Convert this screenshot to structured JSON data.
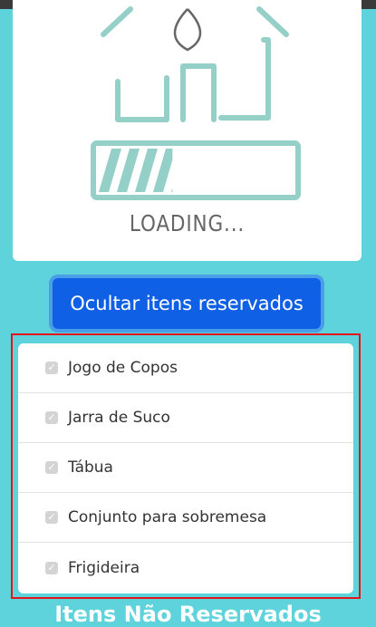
{
  "loading": {
    "text": "LOADING...",
    "progress": 0.38,
    "accent_color": "#94cfc8"
  },
  "toggle_button": {
    "label": "Ocultar itens reservados"
  },
  "reserved_items": [
    {
      "label": "Jogo de Copos",
      "checked": true
    },
    {
      "label": "Jarra de Suco",
      "checked": true
    },
    {
      "label": "Tábua",
      "checked": true
    },
    {
      "label": "Conjunto para sobremesa",
      "checked": true
    },
    {
      "label": "Frigideira",
      "checked": true
    }
  ],
  "section": {
    "title": "Itens Não Reservados"
  },
  "colors": {
    "background": "#5fd3dc",
    "button": "#1060e6",
    "highlight_border": "#e3141b"
  }
}
